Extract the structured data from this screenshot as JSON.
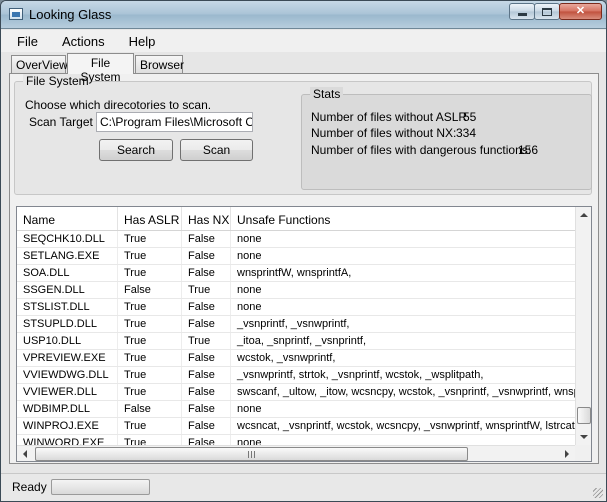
{
  "window": {
    "title": "Looking Glass",
    "close_glyph": "✕"
  },
  "menu": [
    "File",
    "Actions",
    "Help"
  ],
  "tabs": [
    {
      "label": "OverView",
      "active": false
    },
    {
      "label": "File System",
      "active": true
    },
    {
      "label": "Browser",
      "active": false
    }
  ],
  "file_system": {
    "group_title": "File System",
    "instruction": "Choose which direcotories to scan.",
    "scan_target_label": "Scan Target",
    "scan_target_value": "C:\\Program Files\\Microsoft Office\\",
    "search_button": "Search",
    "scan_button": "Scan"
  },
  "stats": {
    "title": "Stats",
    "without_aslr_label": "Number of files without ASLR",
    "without_aslr_value": "55",
    "without_nx_label": "Number of files without NX:",
    "without_nx_value": "334",
    "dangerous_label": "Number of files with dangerous functions:",
    "dangerous_value": "156"
  },
  "grid": {
    "columns": [
      "Name",
      "Has ASLR",
      "Has NX",
      "Unsafe Functions"
    ],
    "rows": [
      [
        "SEQCHK10.DLL",
        "True",
        "False",
        "none"
      ],
      [
        "SETLANG.EXE",
        "True",
        "False",
        "none"
      ],
      [
        "SOA.DLL",
        "True",
        "False",
        "wnsprintfW, wnsprintfA,"
      ],
      [
        "SSGEN.DLL",
        "False",
        "True",
        "none"
      ],
      [
        "STSLIST.DLL",
        "True",
        "False",
        "none"
      ],
      [
        "STSUPLD.DLL",
        "True",
        "False",
        "_vsnprintf, _vsnwprintf,"
      ],
      [
        "USP10.DLL",
        "True",
        "True",
        "_itoa, _snprintf, _vsnprintf,"
      ],
      [
        "VPREVIEW.EXE",
        "True",
        "False",
        "wcstok, _vsnwprintf,"
      ],
      [
        "VVIEWDWG.DLL",
        "True",
        "False",
        "_vsnwprintf, strtok, _vsnprintf, wcstok, _wsplitpath,"
      ],
      [
        "VVIEWER.DLL",
        "True",
        "False",
        "swscanf, _ultow, _itow, wcsncpy, wcstok, _vsnprintf, _vsnwprintf, wnsp"
      ],
      [
        "WDBIMP.DLL",
        "False",
        "False",
        "none"
      ],
      [
        "WINPROJ.EXE",
        "True",
        "False",
        "wcsncat, _vsnprintf, wcstok, wcsncpy, _vsnwprintf, wnsprintfW, lstrcatA"
      ],
      [
        "WINWORD.EXE",
        "True",
        "False",
        "none"
      ]
    ]
  },
  "status": {
    "text": "Ready",
    "progress": 0
  },
  "colors": {
    "progress_fill": "#3fb34f",
    "close_button": "#c0503c"
  },
  "icons": {
    "app": "window-icon",
    "minimize": "minimize-icon",
    "maximize": "maximize-icon",
    "close": "close-icon"
  }
}
